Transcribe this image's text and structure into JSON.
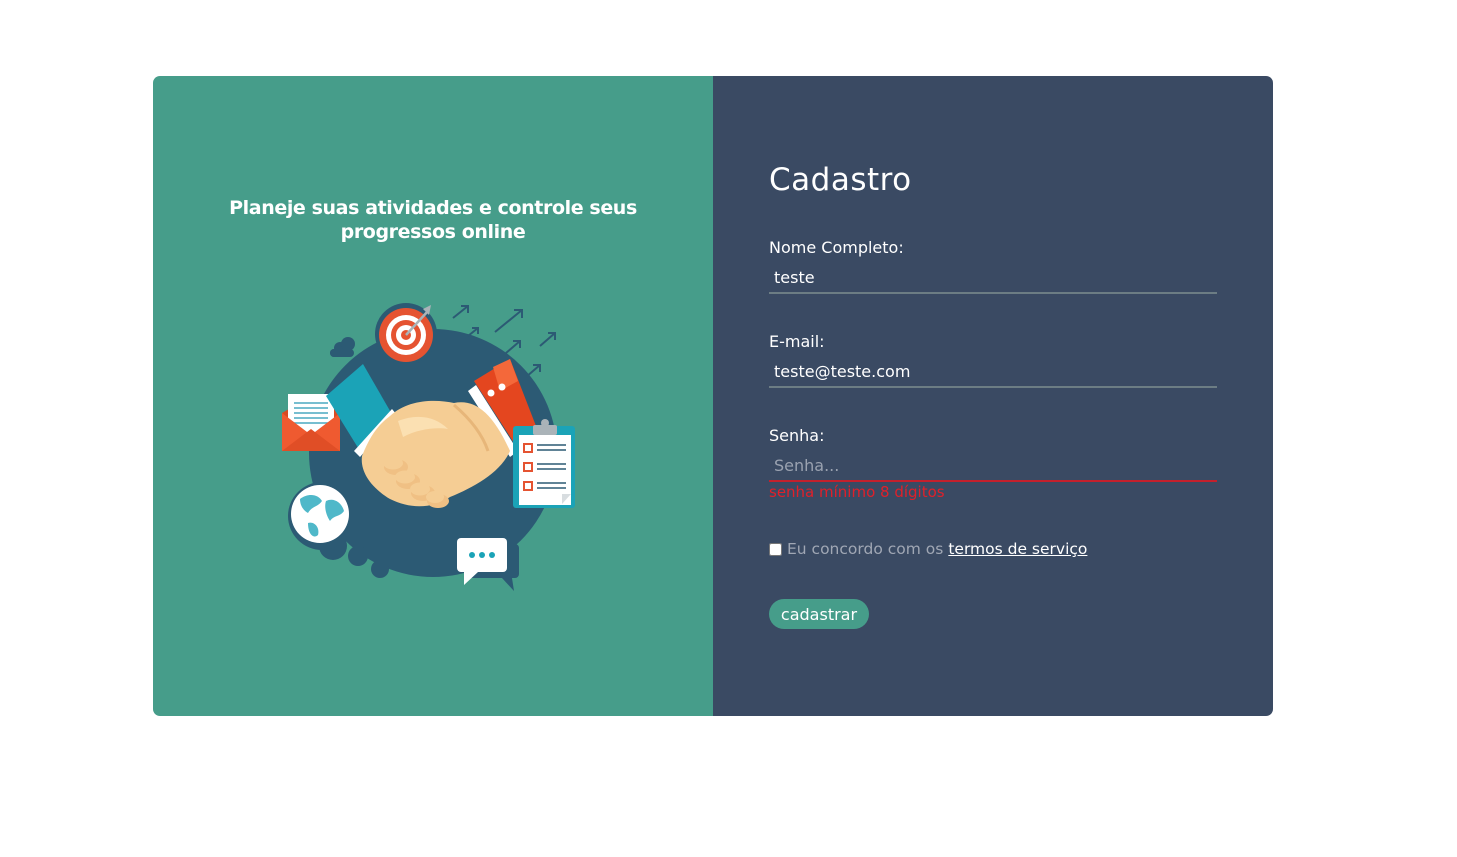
{
  "hero": {
    "tagline": "Planeje suas atividades e controle seus progressos online"
  },
  "form": {
    "title": "Cadastro",
    "fields": {
      "name": {
        "label": "Nome Completo:",
        "value": "teste"
      },
      "email": {
        "label": "E-mail:",
        "value": "teste@teste.com"
      },
      "password": {
        "label": "Senha:",
        "value": "",
        "placeholder": "Senha...",
        "error": "senha mínimo 8 dígitos"
      }
    },
    "terms": {
      "prefix": "Eu concordo com os",
      "link": "termos de serviço",
      "checked": false
    },
    "submit_label": "cadastrar"
  },
  "icons": [
    "handshake-icon",
    "target-icon",
    "mail-icon",
    "checklist-icon",
    "globe-icon",
    "chat-icon",
    "gear-icon",
    "cloud-icon",
    "arrow-up-icon"
  ],
  "colors": {
    "left_panel": "#469d8a",
    "right_panel": "#3a4a63",
    "accent": "#469d8a",
    "error": "#e0202a"
  }
}
